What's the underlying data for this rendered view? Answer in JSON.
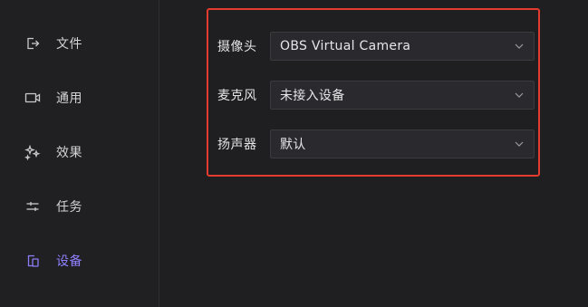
{
  "sidebar": {
    "items": [
      {
        "label": "文件",
        "icon": "file-export-icon"
      },
      {
        "label": "通用",
        "icon": "video-icon"
      },
      {
        "label": "效果",
        "icon": "sparkle-icon"
      },
      {
        "label": "任务",
        "icon": "sliders-icon"
      },
      {
        "label": "设备",
        "icon": "device-icon",
        "active": true
      }
    ]
  },
  "devices": {
    "camera": {
      "label": "摄像头",
      "value": "OBS Virtual Camera"
    },
    "microphone": {
      "label": "麦克风",
      "value": "未接入设备"
    },
    "speaker": {
      "label": "扬声器",
      "value": "默认"
    }
  },
  "colors": {
    "accent": "#8f80ff",
    "highlight": "#e53b2f",
    "background": "#1f1f22"
  }
}
